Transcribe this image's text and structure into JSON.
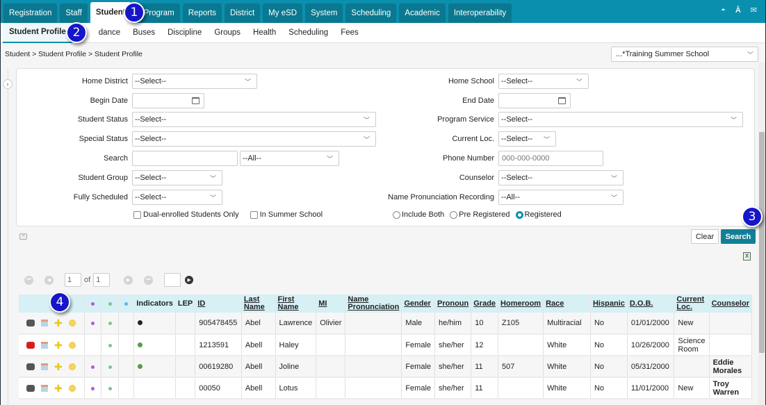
{
  "topnav": {
    "tabs": [
      "Registration",
      "Staff",
      "Student",
      "Program",
      "Reports",
      "District",
      "My eSD",
      "System",
      "Scheduling",
      "Academic",
      "Interoperability"
    ],
    "active": "Student",
    "icons": [
      "dashboard-icon",
      "language-icon",
      "mail-icon"
    ]
  },
  "subnav": {
    "tabs": [
      "Student Profile",
      "Attendance",
      "Buses",
      "Discipline",
      "Groups",
      "Health",
      "Scheduling",
      "Fees"
    ],
    "active": "Student Profile",
    "visible_labels": [
      "Student Profile",
      "dance",
      "Buses",
      "Discipline",
      "Groups",
      "Health",
      "Scheduling",
      "Fees"
    ]
  },
  "breadcrumb": "Student > Student Profile > Student Profile",
  "school_select": "...*Training Summer School",
  "filters": {
    "home_district": {
      "label": "Home District",
      "value": "--Select--"
    },
    "begin_date": {
      "label": "Begin Date",
      "value": ""
    },
    "student_status": {
      "label": "Student Status",
      "value": "--Select--"
    },
    "special_status": {
      "label": "Special Status",
      "value": "--Select--"
    },
    "search": {
      "label": "Search",
      "value": "",
      "scope": "--All--"
    },
    "student_group": {
      "label": "Student Group",
      "value": "--Select--"
    },
    "fully_scheduled": {
      "label": "Fully Scheduled",
      "value": "--Select--"
    },
    "home_school": {
      "label": "Home School",
      "value": "--Select--"
    },
    "end_date": {
      "label": "End Date",
      "value": ""
    },
    "program_service": {
      "label": "Program Service",
      "value": "--Select--"
    },
    "current_loc": {
      "label": "Current Loc.",
      "value": "--Select--"
    },
    "phone_number": {
      "label": "Phone Number",
      "placeholder": "000-000-0000"
    },
    "counselor": {
      "label": "Counselor",
      "value": "--Select--"
    },
    "name_pronunciation": {
      "label": "Name Pronunciation Recording",
      "value": "--All--"
    },
    "checkboxes": [
      {
        "label": "Dual-enrolled Students Only",
        "checked": false
      },
      {
        "label": "In Summer School",
        "checked": false
      }
    ],
    "radios": [
      {
        "label": "Include Both",
        "selected": false
      },
      {
        "label": "Pre Registered",
        "selected": false
      },
      {
        "label": "Registered",
        "selected": true
      }
    ]
  },
  "buttons": {
    "clear": "Clear",
    "search": "Search"
  },
  "pager": {
    "page": "1",
    "of_label": "of",
    "total": "1",
    "goto": ""
  },
  "table": {
    "headers": [
      "",
      "•",
      "•",
      "•",
      "Indicators",
      "LEP",
      "ID",
      "Last Name",
      "First Name",
      "MI",
      "Name Pronunciation",
      "Gender",
      "Pronoun",
      "Grade",
      "Homeroom",
      "Race",
      "Hispanic",
      "D.O.B.",
      "Current Loc.",
      "Counselor"
    ],
    "rows": [
      {
        "phone_alert": false,
        "purple": true,
        "green": true,
        "blue": false,
        "indicator": "#222222",
        "lep": "",
        "id": "905478455",
        "last": "Abel",
        "first": "Lawrence",
        "mi": "Olivier",
        "pron_name": "",
        "gender": "Male",
        "pronoun": "he/him",
        "grade": "10",
        "homeroom": "Z105",
        "race": "Multiracial",
        "hispanic": "No",
        "dob": "01/01/2000",
        "loc": "New",
        "counselor": ""
      },
      {
        "phone_alert": true,
        "purple": false,
        "green": true,
        "blue": false,
        "indicator": "#5a9a4a",
        "lep": "",
        "id": "1213591",
        "last": "Abell",
        "first": "Haley",
        "mi": "",
        "pron_name": "",
        "gender": "Female",
        "pronoun": "she/her",
        "grade": "12",
        "homeroom": "",
        "race": "White",
        "hispanic": "No",
        "dob": "10/26/2000",
        "loc": "Science Room",
        "counselor": ""
      },
      {
        "phone_alert": false,
        "purple": true,
        "green": true,
        "blue": false,
        "indicator": "#5a9a4a",
        "lep": "",
        "id": "00619280",
        "last": "Abell",
        "first": "Joline",
        "mi": "",
        "pron_name": "",
        "gender": "Female",
        "pronoun": "she/her",
        "grade": "11",
        "homeroom": "507",
        "race": "White",
        "hispanic": "No",
        "dob": "05/31/2000",
        "loc": "",
        "counselor": "Eddie Morales"
      },
      {
        "phone_alert": false,
        "purple": true,
        "green": true,
        "blue": false,
        "indicator": "",
        "lep": "",
        "id": "00050",
        "last": "Abell",
        "first": "Lotus",
        "mi": "",
        "pron_name": "",
        "gender": "Female",
        "pronoun": "she/her",
        "grade": "11",
        "homeroom": "",
        "race": "White",
        "hispanic": "No",
        "dob": "11/01/2000",
        "loc": "New",
        "counselor": "Troy Warren"
      }
    ]
  },
  "callouts": [
    "1",
    "2",
    "3",
    "4"
  ],
  "colors": {
    "brand": "#0b8fae",
    "button": "#137f96",
    "header_bg": "#d6f0f5",
    "callout": "#1616c8"
  }
}
